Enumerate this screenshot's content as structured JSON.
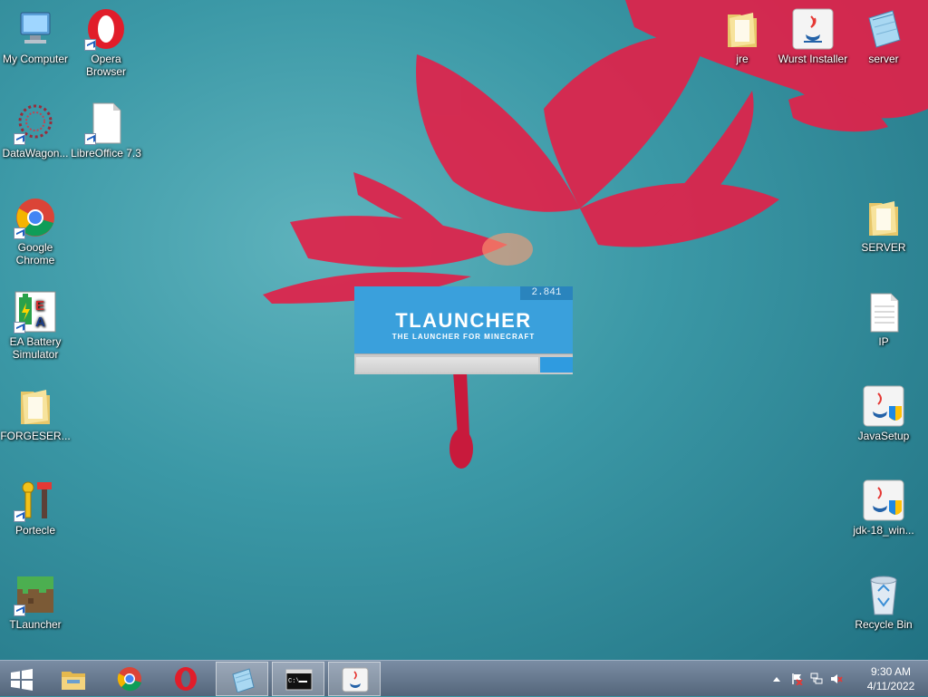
{
  "desktop_icons_left": [
    {
      "label": "My Computer",
      "icon": "computer-icon"
    },
    {
      "label": "Opera Browser",
      "icon": "opera-icon"
    },
    {
      "label": "DataWagon...",
      "icon": "datawagon-icon"
    },
    {
      "label": "LibreOffice 7.3",
      "icon": "libreoffice-icon"
    },
    {
      "label": "Google Chrome",
      "icon": "chrome-icon"
    },
    {
      "label": "EA Battery Simulator",
      "icon": "ea-battery-icon"
    },
    {
      "label": "FORGESER...",
      "icon": "folder-icon"
    },
    {
      "label": "Portecle",
      "icon": "portecle-icon"
    },
    {
      "label": "TLauncher",
      "icon": "tlauncher-icon"
    }
  ],
  "desktop_icons_right": [
    {
      "label": "jre",
      "icon": "folder-icon"
    },
    {
      "label": "Wurst Installer",
      "icon": "java-icon"
    },
    {
      "label": "server",
      "icon": "notepad-icon"
    },
    {
      "label": "SERVER",
      "icon": "folder-icon"
    },
    {
      "label": "IP",
      "icon": "text-file-icon"
    },
    {
      "label": "JavaSetup",
      "icon": "java-setup-icon"
    },
    {
      "label": "jdk-18_win...",
      "icon": "java-setup-icon"
    },
    {
      "label": "Recycle Bin",
      "icon": "recycle-bin-icon"
    }
  ],
  "splash": {
    "version": "2.841",
    "title": "TLAUNCHER",
    "subtitle": "THE LAUNCHER FOR MINECRAFT",
    "progress_fraction": 0.85,
    "accent": "#3aa0dc"
  },
  "taskbar": {
    "items": [
      {
        "name": "start-button",
        "icon": "windows-icon"
      },
      {
        "name": "explorer-taskbar-button",
        "icon": "explorer-icon"
      },
      {
        "name": "chrome-taskbar-button",
        "icon": "chrome-icon"
      },
      {
        "name": "opera-taskbar-button",
        "icon": "opera-icon"
      },
      {
        "name": "notepad-taskbar-button",
        "icon": "notepad-icon"
      },
      {
        "name": "cmd-taskbar-button",
        "icon": "cmd-icon"
      },
      {
        "name": "java-taskbar-button",
        "icon": "java-icon"
      }
    ],
    "clock_time": "9:30 AM",
    "clock_date": "4/11/2022"
  }
}
